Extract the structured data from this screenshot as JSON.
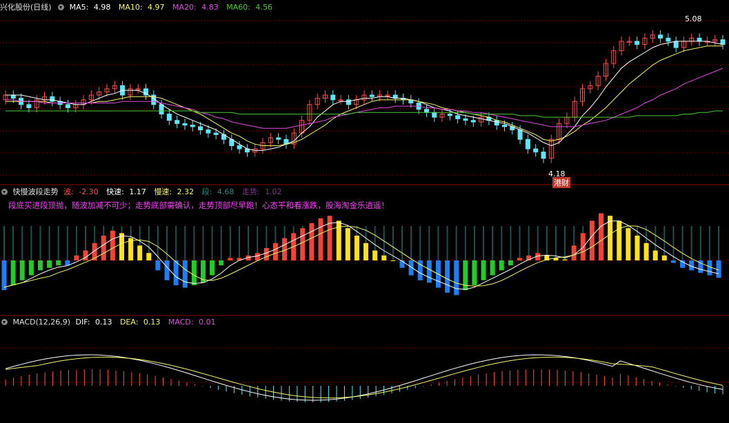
{
  "colors": {
    "up": "#ff4d4d",
    "down": "#5ee6f7",
    "ma5": "#ffffff",
    "ma10": "#f7f76a",
    "ma20": "#e04ce0",
    "ma60": "#4ccc33",
    "grid": "#8b0000",
    "bar_red": "#f44336",
    "bar_yellow": "#ffe11a",
    "bar_green": "#22cc22",
    "bar_blue": "#1e7ff5",
    "teal": "#2e7070",
    "purple": "#6a2a7a",
    "magenta_text": "#ff40ff"
  },
  "main_panel": {
    "title": "兴化股份(日线)",
    "ma5": {
      "label": "MA5:",
      "value": "4.98"
    },
    "ma10": {
      "label": "MA10:",
      "value": "4.97"
    },
    "ma20": {
      "label": "MA20:",
      "value": "4.83"
    },
    "ma60": {
      "label": "MA60:",
      "value": "4.56"
    },
    "high_marker": "5.08",
    "low_marker": "4.18",
    "tag": "港财"
  },
  "wave_panel": {
    "title": "快慢波段走势",
    "wave": {
      "label": "波:",
      "value": "-2.30"
    },
    "fast": {
      "label": "快速:",
      "value": "1.17"
    },
    "slow": {
      "label": "慢速:",
      "value": "2.32"
    },
    "segment": {
      "label": "段:",
      "value": "4.68"
    },
    "trend": {
      "label": "走势:",
      "value": "1.02"
    },
    "slogan": "段底买进段顶抛，随波加减不可少；走势底部需确认，走势顶部尽早跑！心态平和看涨跌，股海淘金乐逍遥！"
  },
  "macd_panel": {
    "title": "MACD(12,26,9)",
    "dif": {
      "label": "DIF:",
      "value": "0.13"
    },
    "dea": {
      "label": "DEA:",
      "value": "0.13"
    },
    "macd": {
      "label": "MACD:",
      "value": "0.01"
    }
  },
  "chart_data": [
    {
      "type": "candlestick",
      "title": "兴化股份(日线)",
      "ylim": [
        4.12,
        5.2
      ],
      "series": [
        {
          "name": "MA5",
          "values": [
            4.66,
            4.66,
            4.66,
            4.65,
            4.64,
            4.63,
            4.63,
            4.62,
            4.61,
            4.6,
            4.6,
            4.62,
            4.64,
            4.66,
            4.67,
            4.69,
            4.69,
            4.69,
            4.67,
            4.64,
            4.6,
            4.57,
            4.54,
            4.52,
            4.5,
            4.48,
            4.46,
            4.44,
            4.41,
            4.38,
            4.35,
            4.32,
            4.31,
            4.31,
            4.32,
            4.33,
            4.35,
            4.37,
            4.42,
            4.46,
            4.52,
            4.56,
            4.6,
            4.62,
            4.62,
            4.63,
            4.64,
            4.64,
            4.65,
            4.65,
            4.64,
            4.64,
            4.63,
            4.62,
            4.6,
            4.58,
            4.57,
            4.56,
            4.54,
            4.53,
            4.52,
            4.51,
            4.5,
            4.49,
            4.48,
            4.46,
            4.44,
            4.42,
            4.39,
            4.36,
            4.34,
            4.36,
            4.41,
            4.46,
            4.53,
            4.58,
            4.64,
            4.71,
            4.77,
            4.83,
            4.87,
            4.9,
            4.93,
            4.96,
            4.98,
            4.99,
            5.0,
            5.0,
            5.0,
            5.0,
            5.0,
            4.99,
            4.98
          ]
        },
        {
          "name": "MA10",
          "values": [
            4.62,
            4.62,
            4.62,
            4.62,
            4.62,
            4.62,
            4.61,
            4.61,
            4.61,
            4.61,
            4.61,
            4.61,
            4.62,
            4.62,
            4.63,
            4.64,
            4.65,
            4.65,
            4.65,
            4.65,
            4.64,
            4.62,
            4.6,
            4.58,
            4.56,
            4.54,
            4.51,
            4.48,
            4.45,
            4.42,
            4.4,
            4.37,
            4.35,
            4.34,
            4.34,
            4.34,
            4.35,
            4.36,
            4.38,
            4.41,
            4.44,
            4.47,
            4.51,
            4.54,
            4.56,
            4.58,
            4.6,
            4.62,
            4.63,
            4.63,
            4.63,
            4.63,
            4.63,
            4.62,
            4.61,
            4.6,
            4.58,
            4.57,
            4.56,
            4.55,
            4.54,
            4.53,
            4.52,
            4.5,
            4.49,
            4.47,
            4.45,
            4.43,
            4.41,
            4.38,
            4.37,
            4.38,
            4.4,
            4.43,
            4.47,
            4.5,
            4.54,
            4.58,
            4.63,
            4.68,
            4.73,
            4.77,
            4.81,
            4.85,
            4.88,
            4.9,
            4.92,
            4.94,
            4.95,
            4.96,
            4.97,
            4.97,
            4.97
          ]
        },
        {
          "name": "MA20",
          "values": [
            4.63,
            4.63,
            4.62,
            4.62,
            4.62,
            4.61,
            4.61,
            4.61,
            4.61,
            4.61,
            4.61,
            4.61,
            4.61,
            4.61,
            4.61,
            4.62,
            4.62,
            4.62,
            4.62,
            4.62,
            4.61,
            4.6,
            4.59,
            4.58,
            4.57,
            4.55,
            4.54,
            4.52,
            4.51,
            4.49,
            4.48,
            4.47,
            4.46,
            4.45,
            4.45,
            4.45,
            4.45,
            4.46,
            4.47,
            4.48,
            4.49,
            4.5,
            4.52,
            4.53,
            4.54,
            4.55,
            4.56,
            4.57,
            4.58,
            4.58,
            4.59,
            4.59,
            4.59,
            4.59,
            4.58,
            4.58,
            4.57,
            4.57,
            4.56,
            4.56,
            4.55,
            4.55,
            4.54,
            4.53,
            4.52,
            4.51,
            4.5,
            4.49,
            4.48,
            4.47,
            4.46,
            4.46,
            4.46,
            4.46,
            4.47,
            4.48,
            4.49,
            4.5,
            4.52,
            4.54,
            4.56,
            4.58,
            4.61,
            4.63,
            4.66,
            4.68,
            4.7,
            4.73,
            4.75,
            4.77,
            4.79,
            4.81,
            4.83
          ]
        },
        {
          "name": "MA60",
          "values": [
            4.56,
            4.56,
            4.56,
            4.56,
            4.56,
            4.56,
            4.56,
            4.56,
            4.56,
            4.56,
            4.56,
            4.56,
            4.56,
            4.56,
            4.56,
            4.56,
            4.56,
            4.56,
            4.56,
            4.56,
            4.56,
            4.56,
            4.56,
            4.56,
            4.56,
            4.55,
            4.55,
            4.55,
            4.55,
            4.55,
            4.54,
            4.54,
            4.54,
            4.54,
            4.54,
            4.54,
            4.54,
            4.54,
            4.54,
            4.54,
            4.54,
            4.54,
            4.54,
            4.54,
            4.54,
            4.55,
            4.55,
            4.55,
            4.55,
            4.55,
            4.55,
            4.55,
            4.55,
            4.55,
            4.55,
            4.55,
            4.55,
            4.55,
            4.55,
            4.55,
            4.54,
            4.54,
            4.54,
            4.54,
            4.54,
            4.54,
            4.53,
            4.53,
            4.53,
            4.52,
            4.52,
            4.52,
            4.52,
            4.52,
            4.52,
            4.52,
            4.52,
            4.52,
            4.52,
            4.52,
            4.52,
            4.53,
            4.53,
            4.53,
            4.53,
            4.53,
            4.53,
            4.54,
            4.54,
            4.55,
            4.55,
            4.56,
            4.56
          ]
        }
      ],
      "close": [
        4.66,
        4.64,
        4.6,
        4.58,
        4.63,
        4.65,
        4.62,
        4.6,
        4.58,
        4.6,
        4.63,
        4.66,
        4.68,
        4.7,
        4.72,
        4.66,
        4.7,
        4.7,
        4.66,
        4.6,
        4.54,
        4.5,
        4.48,
        4.47,
        4.46,
        4.44,
        4.42,
        4.41,
        4.38,
        4.34,
        4.32,
        4.3,
        4.32,
        4.36,
        4.39,
        4.38,
        4.35,
        4.42,
        4.5,
        4.6,
        4.64,
        4.66,
        4.63,
        4.63,
        4.6,
        4.63,
        4.66,
        4.65,
        4.66,
        4.66,
        4.64,
        4.63,
        4.61,
        4.57,
        4.55,
        4.52,
        4.54,
        4.53,
        4.51,
        4.5,
        4.49,
        4.52,
        4.5,
        4.47,
        4.46,
        4.44,
        4.38,
        4.32,
        4.3,
        4.26,
        4.38,
        4.48,
        4.52,
        4.62,
        4.7,
        4.72,
        4.78,
        4.86,
        4.94,
        5.0,
        5.0,
        4.98,
        5.02,
        5.04,
        5.02,
        5.0,
        4.96,
        5.0,
        5.02,
        5.0,
        5.0,
        5.01,
        4.98
      ],
      "open": [
        4.63,
        4.66,
        4.64,
        4.6,
        4.58,
        4.63,
        4.65,
        4.62,
        4.6,
        4.58,
        4.6,
        4.63,
        4.66,
        4.68,
        4.7,
        4.72,
        4.66,
        4.7,
        4.7,
        4.66,
        4.6,
        4.54,
        4.5,
        4.48,
        4.47,
        4.46,
        4.44,
        4.42,
        4.41,
        4.38,
        4.34,
        4.32,
        4.3,
        4.32,
        4.36,
        4.39,
        4.38,
        4.35,
        4.42,
        4.5,
        4.6,
        4.64,
        4.66,
        4.63,
        4.63,
        4.6,
        4.63,
        4.66,
        4.65,
        4.66,
        4.66,
        4.64,
        4.63,
        4.61,
        4.57,
        4.55,
        4.52,
        4.54,
        4.53,
        4.51,
        4.5,
        4.49,
        4.52,
        4.5,
        4.47,
        4.46,
        4.44,
        4.38,
        4.32,
        4.3,
        4.26,
        4.38,
        4.48,
        4.52,
        4.62,
        4.7,
        4.72,
        4.78,
        4.86,
        4.94,
        5.0,
        5.0,
        4.98,
        5.02,
        5.04,
        5.02,
        5.0,
        4.96,
        5.0,
        5.02,
        5.0,
        5.0,
        5.01
      ]
    },
    {
      "type": "bar",
      "title": "快慢波段走势",
      "ylim": [
        -1,
        1
      ],
      "series": [
        {
          "name": "波",
          "values": [
            -0.6,
            -0.5,
            -0.4,
            -0.3,
            -0.2,
            -0.15,
            -0.1,
            -0.1,
            0.1,
            0.2,
            0.35,
            0.5,
            0.6,
            0.55,
            0.45,
            0.3,
            0.15,
            -0.2,
            -0.4,
            -0.5,
            -0.55,
            -0.5,
            -0.45,
            -0.3,
            -0.1,
            0.05,
            0.05,
            0.1,
            0.15,
            0.25,
            0.35,
            0.45,
            0.55,
            0.65,
            0.75,
            0.85,
            0.9,
            0.8,
            0.65,
            0.5,
            0.35,
            0.2,
            0.1,
            0.0,
            -0.15,
            -0.3,
            -0.4,
            -0.45,
            -0.55,
            -0.65,
            -0.7,
            -0.6,
            -0.5,
            -0.4,
            -0.3,
            -0.2,
            -0.1,
            0.05,
            0.1,
            0.15,
            0.1,
            0.05,
            0.02,
            0.3,
            0.55,
            0.8,
            0.95,
            0.9,
            0.8,
            0.65,
            0.5,
            0.35,
            0.2,
            0.1,
            -0.05,
            -0.15,
            -0.2,
            -0.25,
            -0.3,
            -0.35
          ]
        }
      ]
    },
    {
      "type": "bar",
      "title": "MACD(12,26,9)",
      "series": [
        {
          "name": "DIF",
          "values": [
            0.13
          ]
        },
        {
          "name": "DEA",
          "values": [
            0.13
          ]
        },
        {
          "name": "MACD",
          "values": [
            0.01
          ]
        }
      ]
    }
  ]
}
